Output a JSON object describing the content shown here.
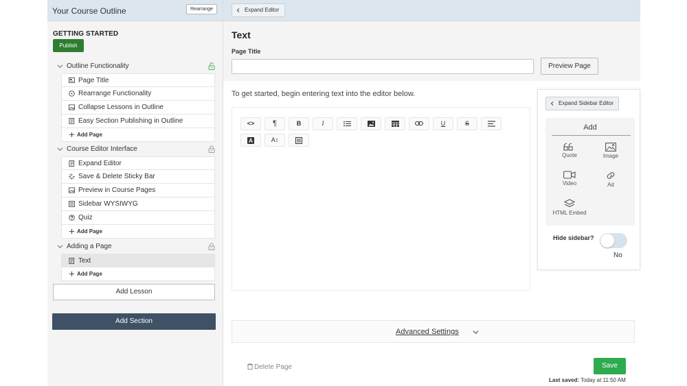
{
  "outline": {
    "title": "Your Course Outline",
    "rearrange_label": "Rearrange",
    "getting_started": "GETTING STARTED",
    "publish_label": "Publish",
    "sections": [
      {
        "title": "Outline Functionality",
        "lock_color": "#4caf50",
        "pages": [
          {
            "label": "Page Title",
            "icon": "layout-icon"
          },
          {
            "label": "Rearrange Functionality",
            "icon": "dots-circle-icon"
          },
          {
            "label": "Collapse Lessons in Outline",
            "icon": "image-icon"
          },
          {
            "label": "Easy Section Publishing in Outline",
            "icon": "document-icon"
          }
        ],
        "add_page": "Add Page"
      },
      {
        "title": "Course Editor Interface",
        "lock_color": "#9e9e9e",
        "pages": [
          {
            "label": "Expand Editor",
            "icon": "document-icon"
          },
          {
            "label": "Save & Delete Sticky Bar",
            "icon": "spinner-icon"
          },
          {
            "label": "Preview in Course Pages",
            "icon": "image-icon"
          },
          {
            "label": "Sidebar WYSIWYG",
            "icon": "list-box-icon"
          },
          {
            "label": "Quiz",
            "icon": "question-circle-icon"
          }
        ],
        "add_page": "Add Page"
      },
      {
        "title": "Adding a Page",
        "lock_color": "#9e9e9e",
        "pages": [
          {
            "label": "Text",
            "icon": "document-icon",
            "active": true
          }
        ],
        "add_page": "Add Page"
      }
    ],
    "add_lesson": "Add Lesson",
    "add_section": "Add Section"
  },
  "editor": {
    "expand_editor": "Expand Editor",
    "heading": "Text",
    "page_title_label": "Page Title",
    "page_title_value": "",
    "preview_label": "Preview Page",
    "intro": "To get started, begin entering text into the editor below.",
    "toolbar": [
      {
        "name": "code-view-icon",
        "glyph": "<>"
      },
      {
        "name": "paragraph-icon",
        "glyph": "¶"
      },
      {
        "name": "bold-icon",
        "glyph": "B"
      },
      {
        "name": "italic-icon",
        "glyph": "I"
      },
      {
        "name": "list-icon",
        "glyph": ""
      },
      {
        "name": "insert-image-icon",
        "glyph": ""
      },
      {
        "name": "insert-table-icon",
        "glyph": ""
      },
      {
        "name": "link-icon",
        "glyph": ""
      },
      {
        "name": "underline-icon",
        "glyph": "U"
      },
      {
        "name": "strikethrough-icon",
        "glyph": "S"
      },
      {
        "name": "align-icon",
        "glyph": ""
      },
      {
        "name": "text-color-icon",
        "glyph": "A"
      },
      {
        "name": "font-size-icon",
        "glyph": "A↕"
      },
      {
        "name": "format-block-icon",
        "glyph": ""
      }
    ],
    "sidebar": {
      "expand_label": "Expand Sidebar Editor",
      "add_title": "Add",
      "items": [
        {
          "label": "Quote",
          "icon": "quote-icon"
        },
        {
          "label": "Image",
          "icon": "image-icon"
        },
        {
          "label": "Video",
          "icon": "video-icon"
        },
        {
          "label": "Ad",
          "icon": "link-icon"
        },
        {
          "label": "HTML Embed",
          "icon": "layers-icon"
        }
      ],
      "hide_label": "Hide sidebar?",
      "hide_state": "No"
    },
    "advanced_settings": "Advanced Settings",
    "delete_page": "Delete Page",
    "save_label": "Save",
    "last_saved_label": "Last saved:",
    "last_saved_value": "Today at 11:50 AM"
  },
  "colors": {
    "header_bg": "#dbe6ee",
    "publish_green": "#2e7d32",
    "save_green": "#2eaa4f",
    "add_section_bg": "#3e5165"
  }
}
